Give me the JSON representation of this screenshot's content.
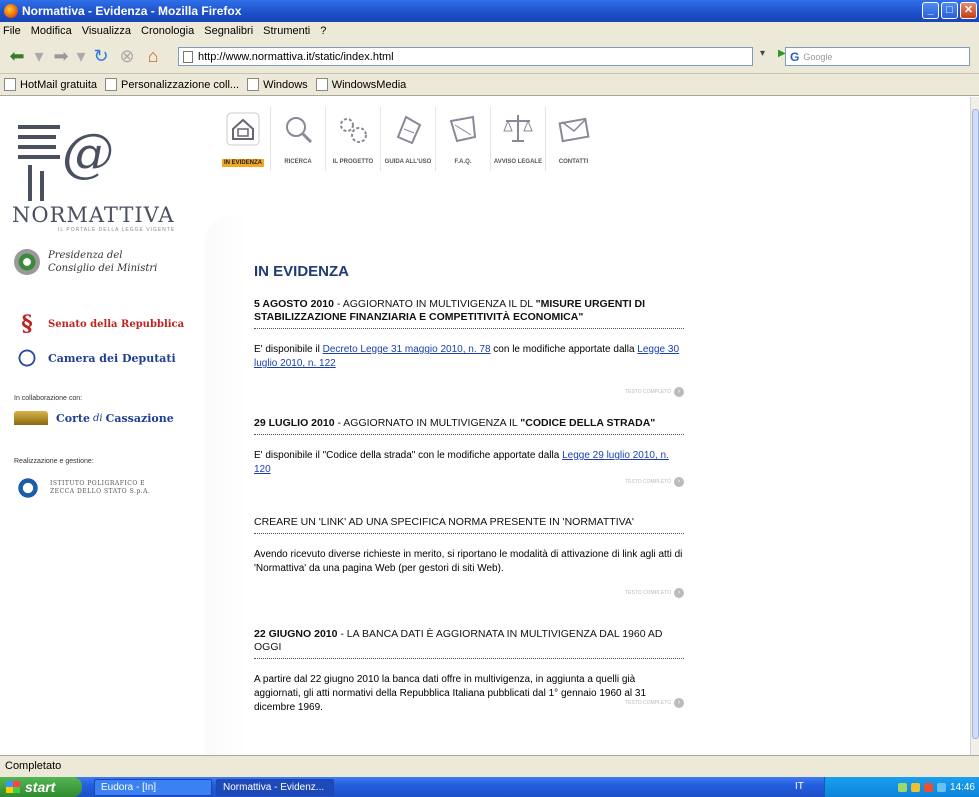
{
  "window": {
    "title": "Normattiva - Evidenza - Mozilla Firefox"
  },
  "menu": [
    "File",
    "Modifica",
    "Visualizza",
    "Cronologia",
    "Segnalibri",
    "Strumenti",
    "?"
  ],
  "navbar": {
    "url": "http://www.normattiva.it/static/index.html",
    "search_placeholder": "Google",
    "search_engine": "G"
  },
  "bookmarks": [
    "HotMail gratuita",
    "Personalizzazione coll...",
    "Windows",
    "WindowsMedia"
  ],
  "site": {
    "brand": "NORMATTIVA",
    "brand_sub": "IL PORTALE DELLA LEGGE VIGENTE",
    "nav": [
      {
        "label": "IN EVIDENZA",
        "icon": "home-icon"
      },
      {
        "label": "RICERCA",
        "icon": "magnifier-icon"
      },
      {
        "label": "IL PROGETTO",
        "icon": "gears-icon"
      },
      {
        "label": "GUIDA ALL'USO",
        "icon": "guide-icon"
      },
      {
        "label": "F.A.Q.",
        "icon": "faq-icon"
      },
      {
        "label": "AVVISO LEGALE",
        "icon": "scales-icon"
      },
      {
        "label": "CONTATTI",
        "icon": "envelope-icon"
      }
    ],
    "institutions": {
      "presidenza": "Presidenza del Consiglio dei Ministri",
      "senato": "Senato della Repubblica",
      "camera": "Camera dei Deputati",
      "collab_label": "In collaborazione con:",
      "cassazione_pre": "Corte",
      "cassazione_di": "di",
      "cassazione_post": "Cassazione",
      "gestione_label": "Realizzazione e gestione:",
      "poligrafico": "ISTITUTO POLIGRAFICO E ZECCA DELLO STATO S.p.A."
    },
    "section_title": "IN EVIDENZA",
    "more_label": "TESTO COMPLETO",
    "news": [
      {
        "head_bold": "5 AGOSTO 2010",
        "head_mid": " - AGGIORNATO IN MULTIVIGENZA IL DL ",
        "head_bold2": "\"MISURE URGENTI DI STABILIZZAZIONE FINANZIARIA E COMPETITIVITÀ ECONOMICA\"",
        "body_pre": "E' disponibile il ",
        "link1": "Decreto Legge 31 maggio 2010, n. 78",
        "body_mid": " con le modifiche apportate dalla ",
        "link2": "Legge 30 luglio 2010, n. 122",
        "body_post": ""
      },
      {
        "head_bold": "29 LUGLIO 2010",
        "head_mid": " - AGGIORNATO IN MULTIVIGENZA IL ",
        "head_bold2": "\"CODICE DELLA STRADA\"",
        "body_pre": "E' disponibile il \"Codice della strada\" con le modifiche apportate dalla ",
        "link1": "Legge 29 luglio 2010, n. 120",
        "body_mid": "",
        "link2": "",
        "body_post": ""
      },
      {
        "head_bold": "",
        "head_mid": "CREARE UN 'LINK' AD UNA SPECIFICA NORMA PRESENTE IN 'NORMATTIVA'",
        "head_bold2": "",
        "body_pre": "Avendo ricevuto diverse richieste in merito, si riportano le modalità di attivazione di link agli atti di 'Normattiva' da una pagina Web (per gestori di siti Web).",
        "link1": "",
        "body_mid": "",
        "link2": "",
        "body_post": ""
      },
      {
        "head_bold": "22 GIUGNO 2010",
        "head_mid": " - LA BANCA DATI È AGGIORNATA IN MULTIVIGENZA DAL 1960 AD OGGI",
        "head_bold2": "",
        "body_pre": "A partire dal 22 giugno 2010 la banca dati offre in multivigenza, in aggiunta a quelli già aggiornati, gli atti normativi della Repubblica Italiana pubblicati dal 1° gennaio 1960 al 31 dicembre 1969.",
        "link1": "",
        "body_mid": "",
        "link2": "",
        "body_post": ""
      }
    ]
  },
  "status": "Completato",
  "taskbar": {
    "start": "start",
    "tasks": [
      "Eudora - [In]",
      "Normattiva - Evidenz..."
    ],
    "lang": "IT",
    "clock": "14:46"
  }
}
